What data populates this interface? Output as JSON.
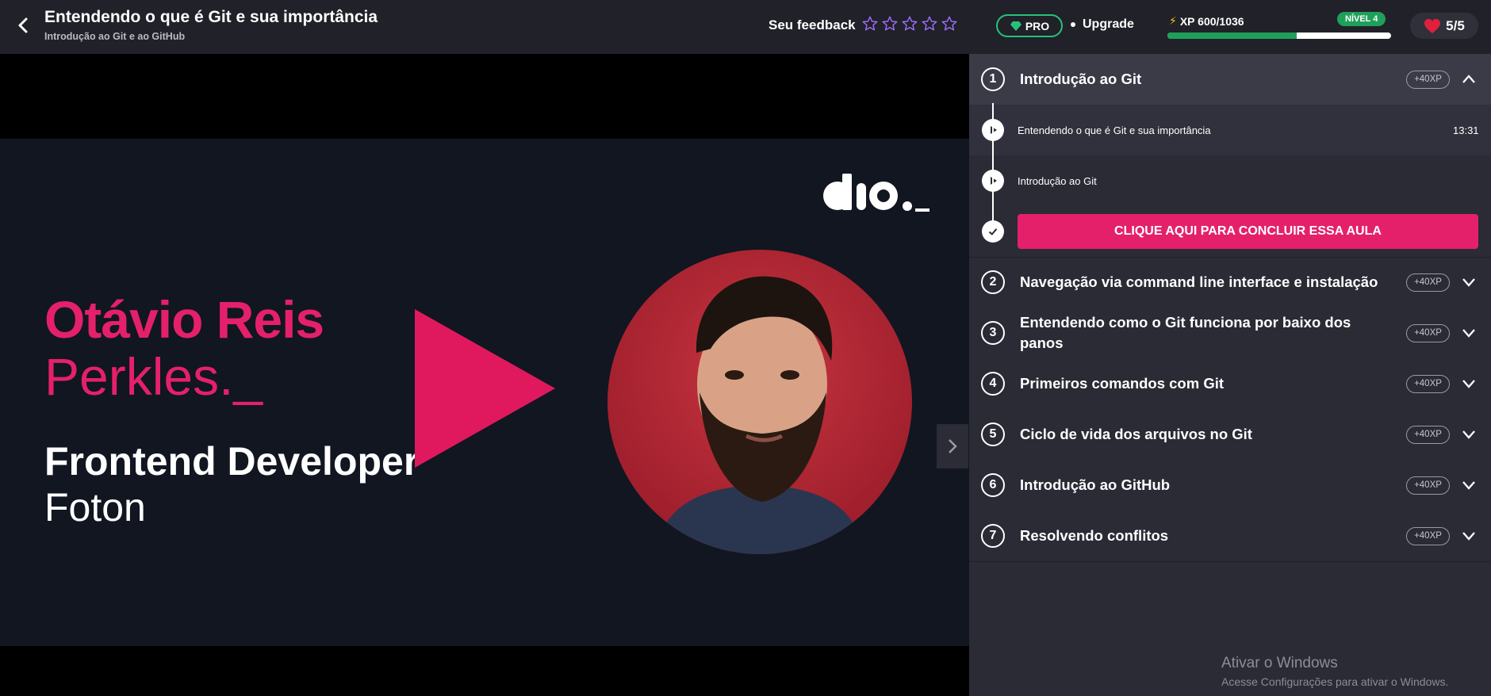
{
  "header": {
    "title": "Entendendo o que é Git e sua importância",
    "subtitle": "Introdução ao Git e ao GitHub",
    "feedback_label": "Seu feedback",
    "stars_count": 5
  },
  "account": {
    "pro_label": "PRO",
    "upgrade_label": "Upgrade",
    "xp_label": "XP 600/1036",
    "xp_current": 600,
    "xp_total": 1036,
    "level_label": "NÍVEL 4",
    "lives_label": "5/5"
  },
  "slide": {
    "name_bold": "Otávio Reis",
    "name_light": "Perkles._",
    "role": "Frontend Developer",
    "company": "Foton"
  },
  "sidebar": {
    "expanded_module": {
      "number": "1",
      "title": "Introdução ao Git",
      "xp": "+40XP",
      "lessons": [
        {
          "name": "Entendendo o que é Git e sua importância",
          "time": "13:31"
        },
        {
          "name": "Introdução ao Git",
          "time": ""
        }
      ],
      "conclude_label": "CLIQUE AQUI PARA CONCLUIR ESSA AULA"
    },
    "modules": [
      {
        "number": "2",
        "title": "Navegação via command line interface e instalação",
        "xp": "+40XP"
      },
      {
        "number": "3",
        "title": "Entendendo como o Git funciona por baixo dos panos",
        "xp": "+40XP"
      },
      {
        "number": "4",
        "title": "Primeiros comandos com Git",
        "xp": "+40XP"
      },
      {
        "number": "5",
        "title": "Ciclo de vida dos arquivos no Git",
        "xp": "+40XP"
      },
      {
        "number": "6",
        "title": "Introdução ao GitHub",
        "xp": "+40XP"
      },
      {
        "number": "7",
        "title": "Resolvendo conflitos",
        "xp": "+40XP"
      }
    ]
  },
  "watermark": {
    "line1": "Ativar o Windows",
    "line2": "Acesse Configurações para ativar o Windows."
  },
  "colors": {
    "accent": "#e5206a",
    "green": "#1ea05a",
    "background": "#2a2b35",
    "header_bg": "#202129",
    "slide_bg": "#111621"
  }
}
